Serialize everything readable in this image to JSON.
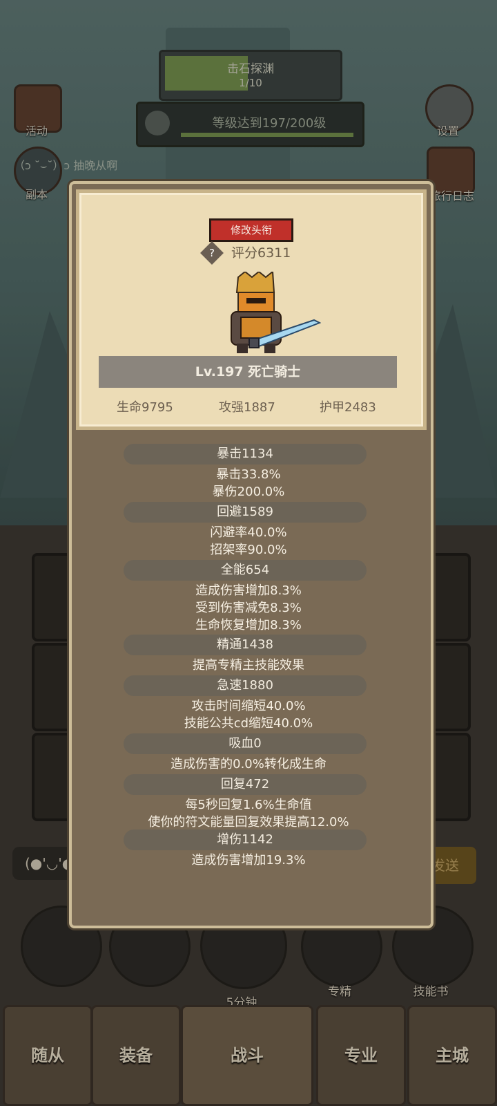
{
  "top": {
    "quest_title": "击石探渊",
    "quest_count": "1/10",
    "level_goal": "等级达到197/200级"
  },
  "side": {
    "left_top_label": "活动",
    "left_mid_label": "副本",
    "right_top_label": "设置",
    "right_mid_label": "旅行日志"
  },
  "chat": {
    "line": "（ɔ ˘⌣˘）ɔ 抽晚从啊",
    "input_emoji": "(●'◡'●",
    "send_label": "发送"
  },
  "actions": {
    "timer_label": "5分钟",
    "specialize_label": "专精",
    "skillbook_label": "技能书"
  },
  "nav": {
    "followers": "随从",
    "equipment": "装备",
    "battle": "战斗",
    "profession": "专业",
    "city": "主城"
  },
  "card": {
    "change_title_label": "修改头衔",
    "score": "评分6311",
    "name": "Lv.197 死亡骑士",
    "stats": {
      "hp": "生命9795",
      "attack": "攻强1887",
      "armor": "护甲2483"
    }
  },
  "sections": [
    {
      "title": "暴击1134",
      "lines": [
        "暴击33.8%",
        "暴伤200.0%"
      ]
    },
    {
      "title": "回避1589",
      "lines": [
        "闪避率40.0%",
        "招架率90.0%"
      ]
    },
    {
      "title": "全能654",
      "lines": [
        "造成伤害增加8.3%",
        "受到伤害减免8.3%",
        "生命恢复增加8.3%"
      ]
    },
    {
      "title": "精通1438",
      "lines": [
        "提高专精主技能效果"
      ]
    },
    {
      "title": "急速1880",
      "lines": [
        "攻击时间缩短40.0%",
        "技能公共cd缩短40.0%"
      ]
    },
    {
      "title": "吸血0",
      "lines": [
        "造成伤害的0.0%转化成生命"
      ]
    },
    {
      "title": "回复472",
      "lines": [
        "每5秒回复1.6%生命值",
        "使你的符文能量回复效果提高12.0%"
      ]
    },
    {
      "title": "增伤1142",
      "lines": [
        "造成伤害增加19.3%"
      ]
    }
  ],
  "colors": {
    "accent_red": "#c0302a",
    "panel": "#7a6a55",
    "card": "#ecdcb6"
  }
}
